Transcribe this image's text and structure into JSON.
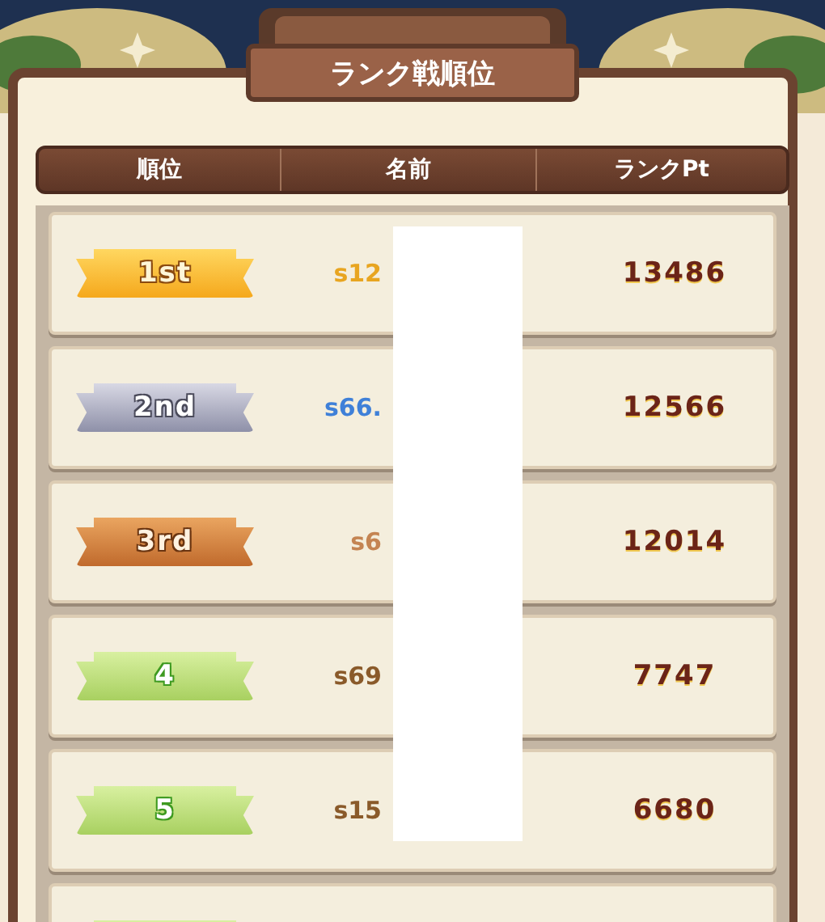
{
  "dialog": {
    "title": "ランク戦順位"
  },
  "table": {
    "columns": [
      "順位",
      "名前",
      "ランクPt"
    ],
    "rows": [
      {
        "kind": "gold",
        "rank": "1st",
        "name": "s12",
        "points": "13486"
      },
      {
        "kind": "silver",
        "rank": "2nd",
        "name": "s66.",
        "points": "12566"
      },
      {
        "kind": "bronze",
        "rank": "3rd",
        "name": "s6",
        "points": "12014"
      },
      {
        "kind": "green",
        "rank": "4",
        "name": "s69",
        "points": "7747"
      },
      {
        "kind": "green",
        "rank": "5",
        "name": "s15",
        "points": "6680"
      },
      {
        "kind": "green"
      }
    ]
  }
}
